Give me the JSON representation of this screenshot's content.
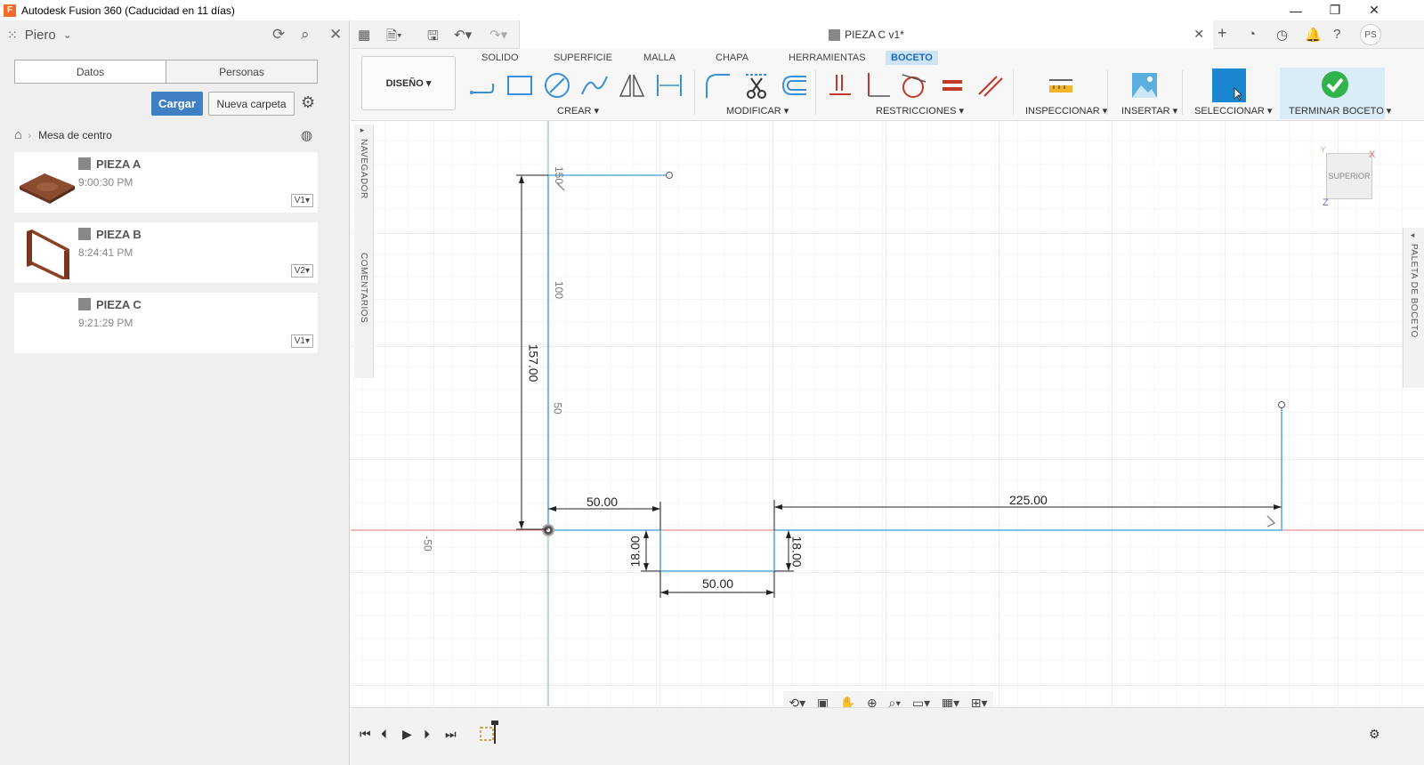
{
  "window": {
    "title": "Autodesk Fusion 360 (Caducidad en 11 días)",
    "app_icon_letter": "F"
  },
  "data_panel": {
    "user": "Piero",
    "tabs": [
      "Datos",
      "Personas"
    ],
    "upload_label": "Cargar",
    "new_folder_label": "Nueva carpeta",
    "breadcrumb": "Mesa de centro",
    "files": [
      {
        "name": "PIEZA A",
        "time": "9:00:30 PM",
        "version": "V1▾"
      },
      {
        "name": "PIEZA B",
        "time": "8:24:41 PM",
        "version": "V2▾"
      },
      {
        "name": "PIEZA C",
        "time": "9:21:29 PM",
        "version": "V1▾"
      }
    ]
  },
  "document": {
    "tab_title": "PIEZA C v1*",
    "user_initials": "PS"
  },
  "ribbon": {
    "workspace": "DISEÑO ▾",
    "tabs": [
      "SOLIDO",
      "SUPERFICIE",
      "MALLA",
      "CHAPA",
      "HERRAMIENTAS",
      "BOCETO"
    ],
    "active_tab": "BOCETO",
    "groups": {
      "crear": "CREAR ▾",
      "modificar": "MODIFICAR ▾",
      "restricciones": "RESTRICCIONES ▾",
      "inspeccionar": "INSPECCIONAR ▾",
      "insertar": "INSERTAR ▾",
      "seleccionar": "SELECCIONAR ▾",
      "terminar": "TERMINAR BOCETO ▾"
    }
  },
  "side_panels": {
    "navigator": "NAVEGADOR",
    "comments": "COMENTARIOS",
    "sketch_palette": "PALETA DE BOCETO"
  },
  "viewcube": {
    "face": "SUPERIOR",
    "axis_x": "X",
    "axis_y": "Y",
    "axis_z": "Z"
  },
  "sketch": {
    "ruler_labels": [
      "150",
      "100",
      "50",
      "-50"
    ],
    "dimensions": {
      "height_total": "157.00",
      "left_width": "50.00",
      "slot_width": "50.00",
      "slot_depth_left": "18.00",
      "slot_depth_right": "18.00",
      "right_length": "225.00"
    }
  },
  "colors": {
    "sketch_line": "#5aaee0",
    "x_axis": "#e07070",
    "y_axis": "#7cc47c",
    "accent": "#3f7fc4",
    "finish_green": "#2fb34a"
  }
}
